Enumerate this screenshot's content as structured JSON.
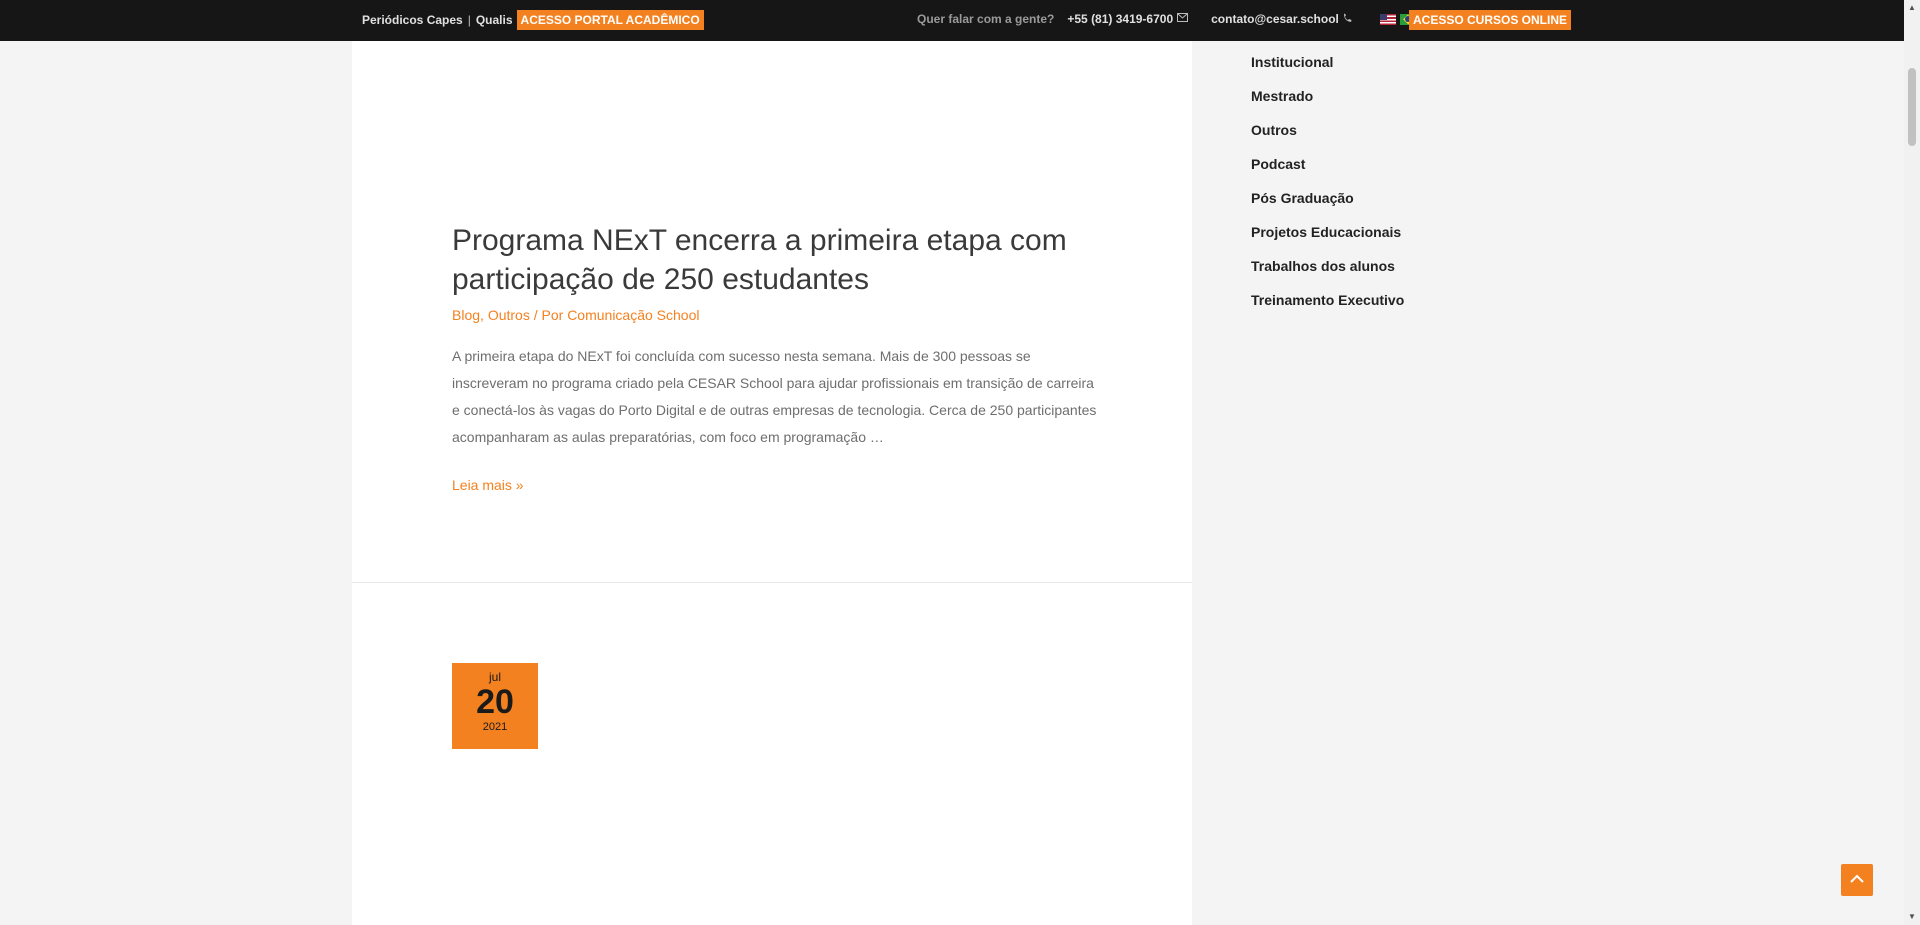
{
  "topbar": {
    "periodicos": "Periódicos Capes",
    "separator": "|",
    "qualis": "Qualis",
    "portal_button": "ACESSO PORTAL ACADÊMICO",
    "contact_lead": "Quer falar com a gente?",
    "phone": "+55 (81) 3419-6700",
    "email": "contato@cesar.school",
    "cursos_button": "ACESSO CURSOS ONLINE",
    "icons": [
      "envelope-icon",
      "phone-icon",
      "flag-us-icon",
      "flag-br-icon"
    ]
  },
  "post": {
    "title": "Programa NExT encerra a primeira etapa com participação de 250 estudantes",
    "category_1": "Blog",
    "category_sep": ", ",
    "category_2": "Outros",
    "author_prefix": " / Por ",
    "author": "Comunicação School",
    "excerpt": "A primeira etapa do NExT foi concluída com sucesso nesta semana. Mais de 300 pessoas se inscreveram no programa criado pela CESAR School para ajudar profissionais em transição de carreira e conectá-los às vagas do Porto Digital e de outras empresas de tecnologia. Cerca de 250 participantes acompanharam as aulas preparatórias, com foco em programação …",
    "read_more": "Leia mais »"
  },
  "next_post_date": {
    "month": "jul",
    "day": "20",
    "year": "2021"
  },
  "sidebar": {
    "categories": [
      {
        "label": "Institucional"
      },
      {
        "label": "Mestrado"
      },
      {
        "label": "Outros"
      },
      {
        "label": "Podcast"
      },
      {
        "label": "Pós Graduação"
      },
      {
        "label": "Projetos Educacionais"
      },
      {
        "label": "Trabalhos dos alunos"
      },
      {
        "label": "Treinamento Executivo"
      }
    ]
  },
  "colors": {
    "accent": "#f4811f",
    "topbar_bg": "#161616",
    "page_bg": "#f4f4f4"
  }
}
